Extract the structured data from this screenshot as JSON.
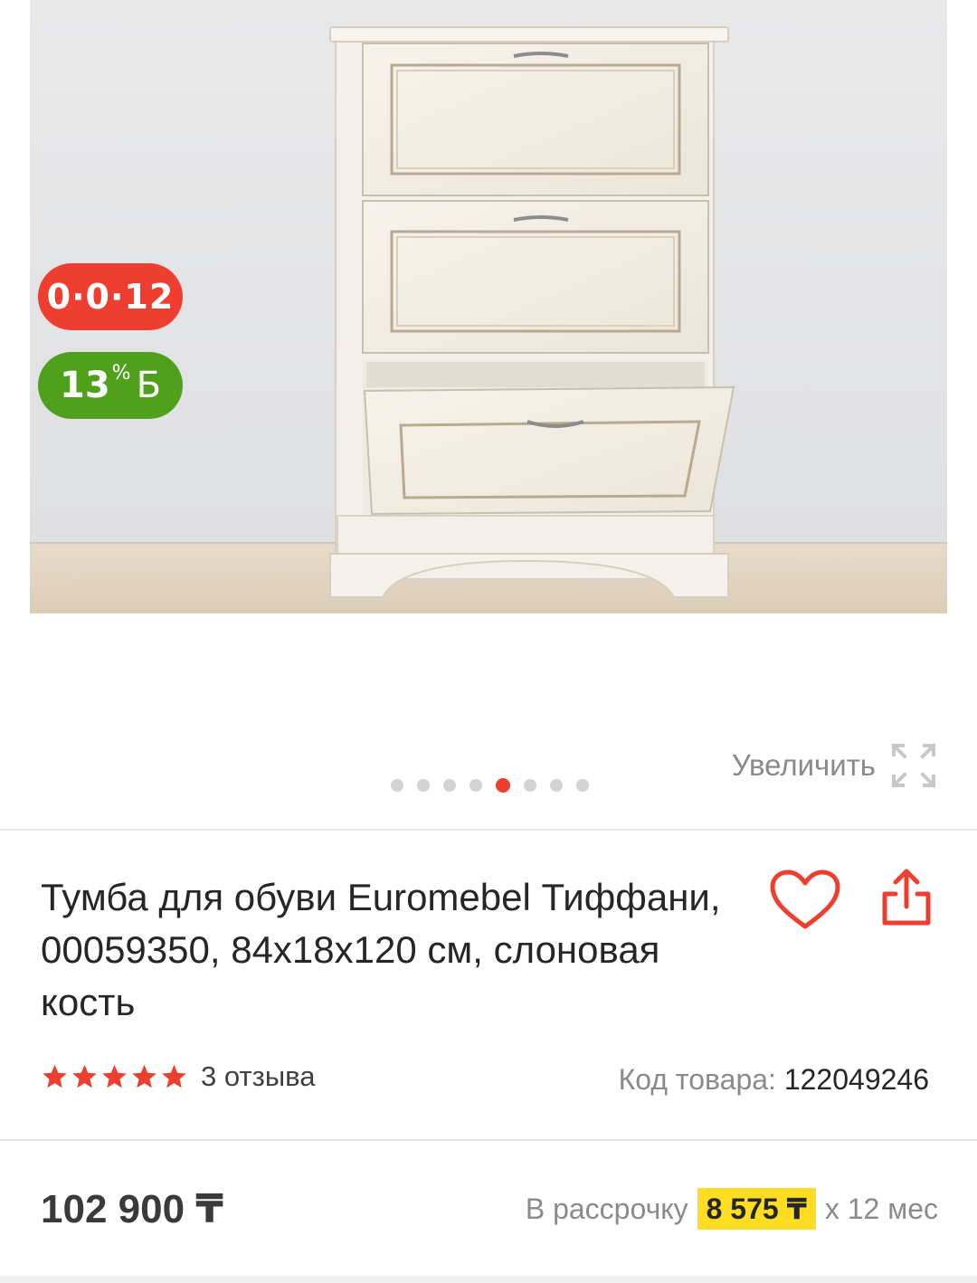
{
  "gallery": {
    "badge_installment": "0·0·12",
    "badge_bonus": {
      "value": "13",
      "percent": "%",
      "symbol": "Б"
    },
    "zoom_label": "Увеличить",
    "pagination": {
      "total": 8,
      "active": 5
    }
  },
  "product": {
    "title": "Тумба для обуви Euromebel Тиффани, 00059350, 84х18х120 см, слоновая кость",
    "rating": 5,
    "reviews": "3 отзыва",
    "sku_label": "Код товара:",
    "sku_value": "122049246",
    "price": "102 900 ₸",
    "credit_prefix": "В рассрочку",
    "credit_amount": "8 575 ₸",
    "credit_suffix": "х 12 мес"
  },
  "colors": {
    "accent_red": "#ee3e2f",
    "bonus_green": "#4fa01a",
    "highlight_yellow": "#ffdd22"
  }
}
